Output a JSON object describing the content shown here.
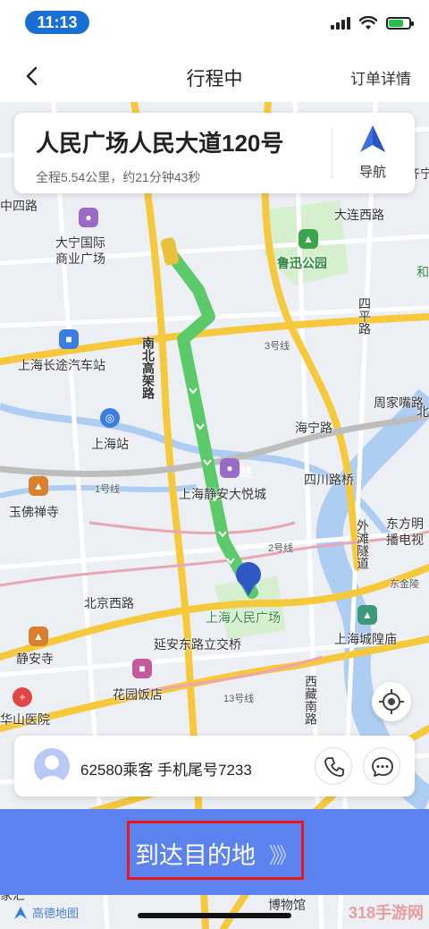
{
  "status_bar": {
    "time": "11:13"
  },
  "nav": {
    "title": "行程中",
    "right_action": "订单详情"
  },
  "destination": {
    "name": "人民广场人民大道120号",
    "meta": "全程5.54公里，约21分钟43秒",
    "nav_button_label": "导航"
  },
  "map": {
    "labels": {
      "daning": "大宁国际\n商业广场",
      "dalian": "大连西路",
      "luxun": "鲁迅公园",
      "coach": "上海长途汽车站",
      "highway": "南北高架路",
      "station": "上海站",
      "line3": "3号线",
      "siping": "四平路",
      "zhoujiazui": "周家嘴路",
      "jingan_joy": "上海静安大悦城",
      "sichuan_bridge": "四川路桥",
      "haining": "海宁路",
      "line1": "1号线",
      "jade_temple": "玉佛禅寺",
      "line2": "2号线",
      "waitan": "外滩隧道",
      "oriental": "东方明\n播电视",
      "beijing_rd": "北京西路",
      "peoples_square": "上海人民广场",
      "yanan": "延安东路立交桥",
      "city_god": "上海城隍庙",
      "jingan_temple": "静安寺",
      "garden_hotel": "花园饭店",
      "line13": "13号线",
      "huashan": "华山医院",
      "xizang": "西藏南路",
      "expo": "上海世博\n博物馆",
      "jiahui": "家汇",
      "end_marker": "终",
      "he": "和",
      "bei": "北",
      "zhongshan_short": "中四路",
      "jinling": "东金陵",
      "qilu": "齐宁"
    }
  },
  "passenger": {
    "text": "62580乘客 手机尾号7233"
  },
  "arrive": {
    "label": "到达目的地",
    "arrows": "》》"
  },
  "footer": {
    "logo": "高德地图",
    "watermark": "318手游网"
  },
  "colors": {
    "accent": "#5b82ef",
    "route": "#5cc96b",
    "highlight_box": "#e8161b"
  }
}
